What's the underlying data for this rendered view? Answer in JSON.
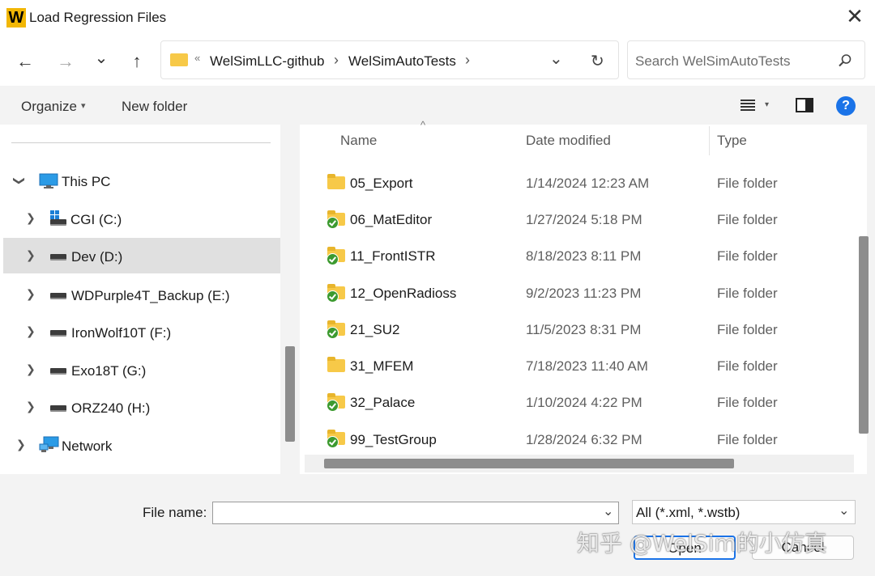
{
  "window": {
    "app_icon_letter": "W",
    "title": "Load Regression Files",
    "close_glyph": "✕"
  },
  "nav": {
    "back_icon": "←",
    "forward_icon": "→",
    "recent_icon": "⌄",
    "up_icon": "↑",
    "address": {
      "overflow": "«",
      "crumbs": [
        "WelSimLLC-github",
        "WelSimAutoTests"
      ],
      "separator": "›",
      "dropdown_icon": "⌄",
      "refresh_icon": "↻"
    },
    "search": {
      "placeholder": "Search WelSimAutoTests",
      "icon": "search-icon"
    }
  },
  "toolbar": {
    "organize_label": "Organize",
    "organize_caret": "▾",
    "new_folder_label": "New folder",
    "view_caret": "▾",
    "help_glyph": "?",
    "accent_color": "#1a73e8"
  },
  "sidebar": {
    "items": [
      {
        "label": "This PC",
        "expanded": true,
        "icon": "monitor-icon"
      },
      {
        "label": "CGI (C:)",
        "icon": "windows-drive-icon"
      },
      {
        "label": "Dev (D:)",
        "icon": "drive-icon",
        "selected": true
      },
      {
        "label": "WDPurple4T_Backup (E:)",
        "icon": "drive-icon"
      },
      {
        "label": "IronWolf10T (F:)",
        "icon": "drive-icon"
      },
      {
        "label": "Exo18T (G:)",
        "icon": "drive-icon"
      },
      {
        "label": "ORZ240 (H:)",
        "icon": "drive-icon"
      },
      {
        "label": "Network",
        "icon": "network-icon"
      }
    ]
  },
  "files": {
    "columns": [
      "Name",
      "Date modified",
      "Type"
    ],
    "sort_indicator": "^",
    "rows": [
      {
        "name": "05_Export",
        "date": "1/14/2024 12:23 AM",
        "type": "File folder",
        "synced": false
      },
      {
        "name": "06_MatEditor",
        "date": "1/27/2024 5:18 PM",
        "type": "File folder",
        "synced": true
      },
      {
        "name": "11_FrontISTR",
        "date": "8/18/2023 8:11 PM",
        "type": "File folder",
        "synced": true
      },
      {
        "name": "12_OpenRadioss",
        "date": "9/2/2023 11:23 PM",
        "type": "File folder",
        "synced": true
      },
      {
        "name": "21_SU2",
        "date": "11/5/2023 8:31 PM",
        "type": "File folder",
        "synced": true
      },
      {
        "name": "31_MFEM",
        "date": "7/18/2023 11:40 AM",
        "type": "File folder",
        "synced": false
      },
      {
        "name": "32_Palace",
        "date": "1/10/2024 4:22 PM",
        "type": "File folder",
        "synced": true
      },
      {
        "name": "99_TestGroup",
        "date": "1/28/2024 6:32 PM",
        "type": "File folder",
        "synced": true
      }
    ]
  },
  "footer": {
    "file_name_label": "File name:",
    "file_name_value": "",
    "file_type_selected": "All (*.xml, *.wstb)",
    "open_label": "Open",
    "cancel_label": "Cancel"
  },
  "watermark": "知乎 @WelSim的小仿真"
}
